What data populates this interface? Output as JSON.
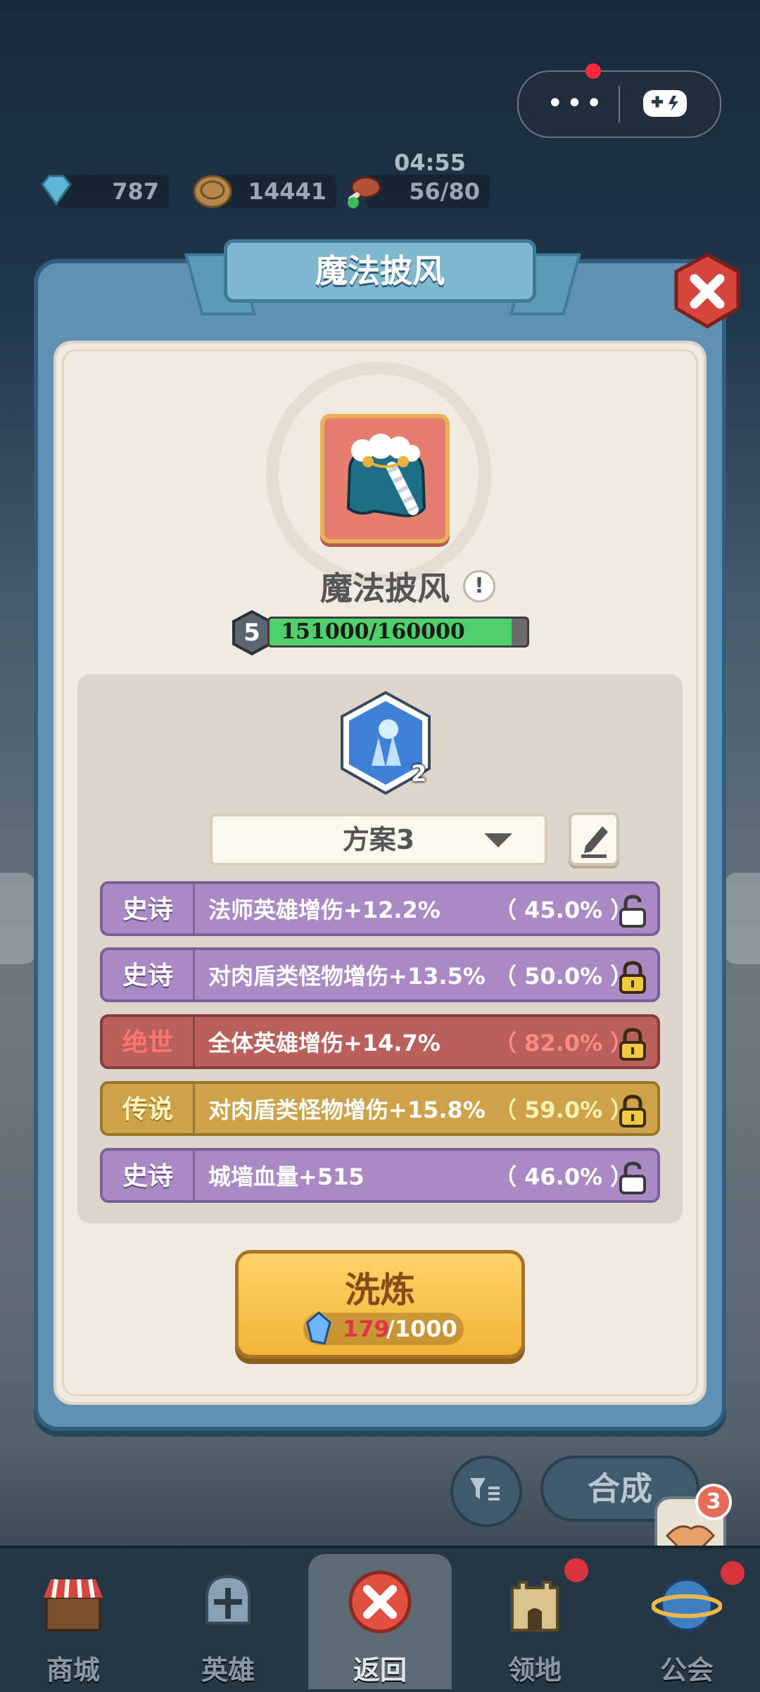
{
  "top": {
    "resources": [
      {
        "icon": "diamond-icon",
        "value": "787"
      },
      {
        "icon": "coin-icon",
        "value": "14441"
      },
      {
        "icon": "meat-icon",
        "value": "56/80"
      }
    ],
    "timer": "04:55"
  },
  "panel": {
    "title": "魔法披风",
    "item_name": "魔法披风",
    "level": "5",
    "exp_text": "151000/160000",
    "exp_progress": 0.94,
    "gem_count": "2",
    "plan": "方案3",
    "attributes": [
      {
        "rarity": "史诗",
        "text": "法师英雄增伤+12.2%",
        "percent": "（ 45.0% ）",
        "tier": "epic",
        "locked": false
      },
      {
        "rarity": "史诗",
        "text": "对肉盾类怪物增伤+13.5%",
        "percent": "（ 50.0% ）",
        "tier": "epic",
        "locked": true
      },
      {
        "rarity": "绝世",
        "text": "全体英雄增伤+14.7%",
        "percent": "（ 82.0% ）",
        "tier": "ult",
        "locked": true
      },
      {
        "rarity": "传说",
        "text": "对肉盾类怪物增伤+15.8%",
        "percent": "（ 59.0% ）",
        "tier": "leg",
        "locked": true
      },
      {
        "rarity": "史诗",
        "text": "城墙血量+515",
        "percent": "（ 46.0% ）",
        "tier": "epic",
        "locked": false
      }
    ],
    "refine": {
      "label": "洗炼",
      "cost_have": "179",
      "cost_need": "/1000"
    }
  },
  "background": {
    "combine_label": "合成",
    "guild_badge": "3"
  },
  "nav": [
    {
      "label": "商城",
      "icon": "shop-icon"
    },
    {
      "label": "英雄",
      "icon": "hero-helmet-icon"
    },
    {
      "label": "返回",
      "icon": "close-icon"
    },
    {
      "label": "领地",
      "icon": "castle-icon"
    },
    {
      "label": "公会",
      "icon": "guild-globe-icon"
    }
  ],
  "colors": {
    "epic": "#a98ac4",
    "ult": "#b95f5c",
    "legend": "#cda24a",
    "accent": "#5f92b2"
  }
}
